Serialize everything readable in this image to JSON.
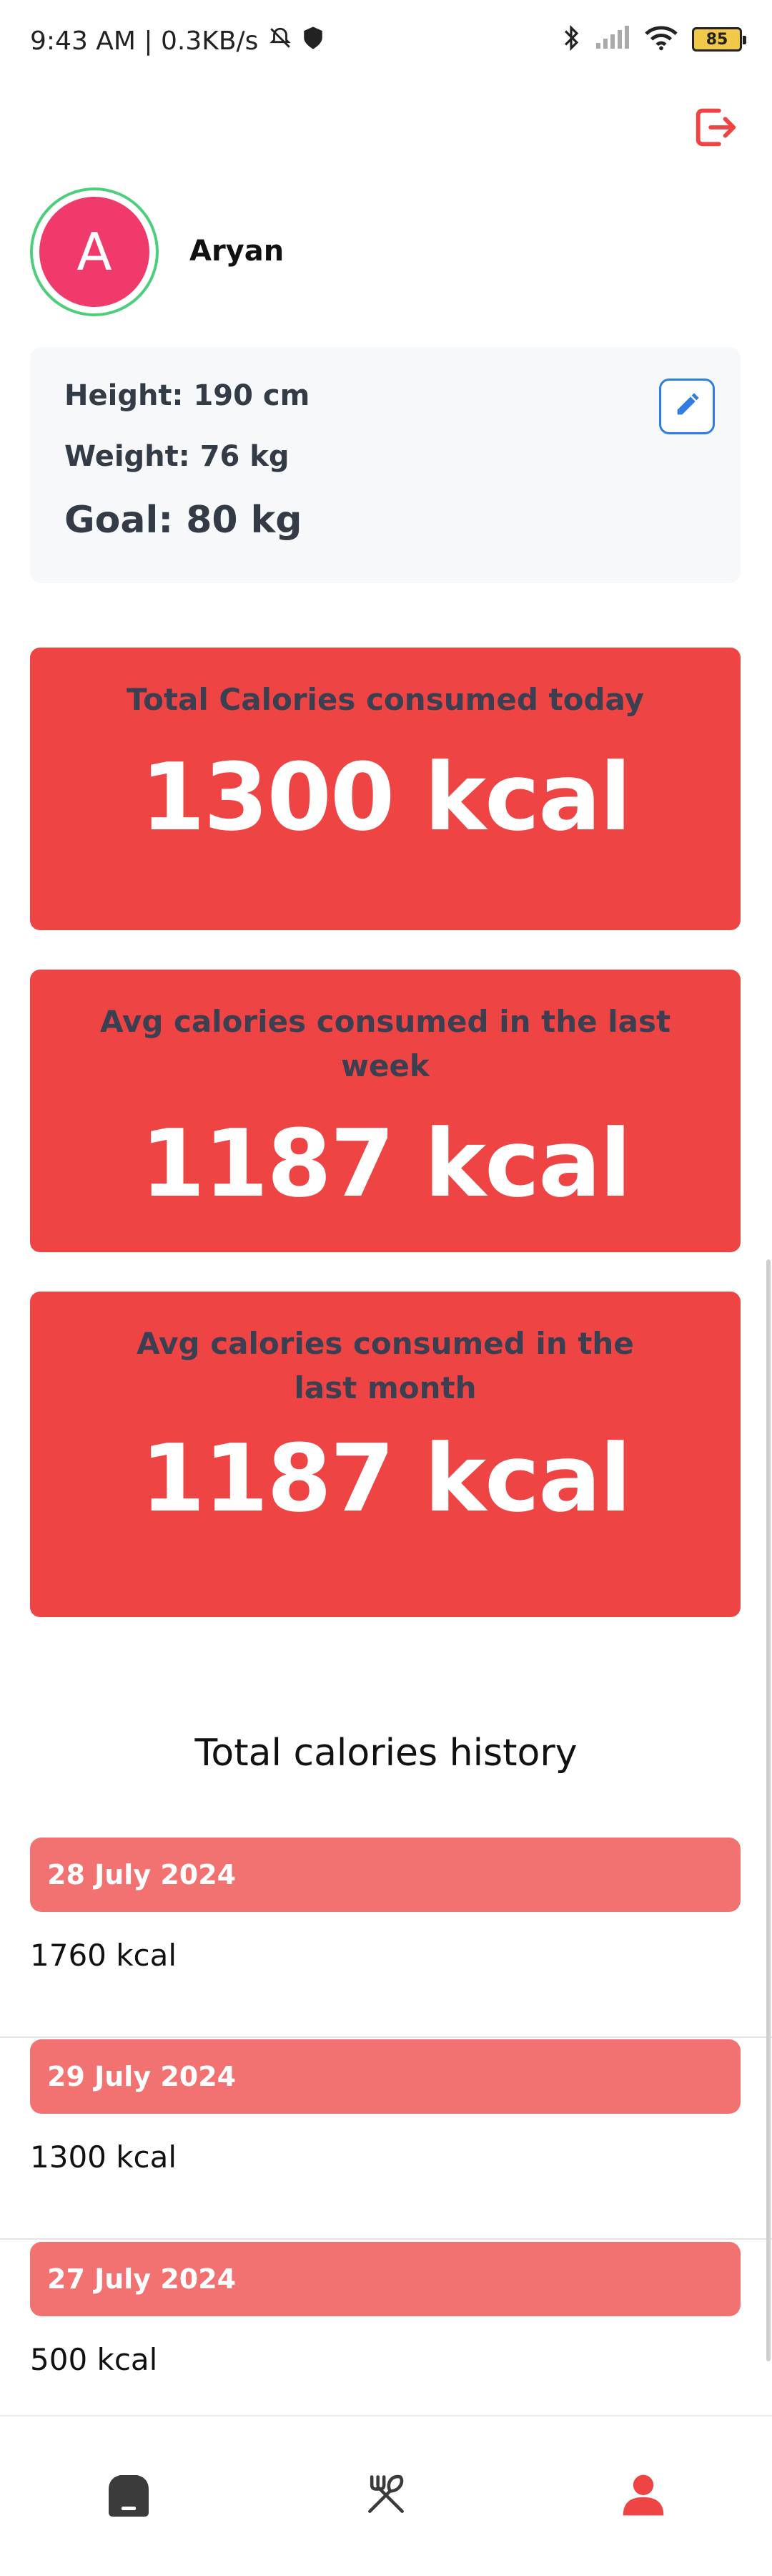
{
  "status_bar": {
    "time_net": "9:43 AM | 0.3KB/s",
    "battery": "85"
  },
  "profile": {
    "avatar_letter": "A",
    "name": "Aryan",
    "height": "Height: 190 cm",
    "weight": "Weight: 76 kg",
    "goal": "Goal: 80 kg"
  },
  "cards": [
    {
      "label": "Total Calories consumed today",
      "value": "1300 kcal"
    },
    {
      "label": "Avg calories consumed in the last week",
      "value": "1187 kcal"
    },
    {
      "label": "Avg calories consumed in the last month",
      "value": "1187 kcal"
    }
  ],
  "history": {
    "title": "Total calories history",
    "items": [
      {
        "date": "28 July 2024",
        "kcal": "1760 kcal"
      },
      {
        "date": "29 July 2024",
        "kcal": "1300 kcal"
      },
      {
        "date": "27 July 2024",
        "kcal": "500 kcal"
      }
    ]
  },
  "nav": {
    "items": [
      "home-icon",
      "utensils-icon",
      "profile-icon"
    ],
    "active": "profile-icon",
    "active_color": "#ef4444",
    "inactive_color": "#3b3b3b"
  },
  "colors": {
    "card": "#ef4444",
    "history_header": "#f27171",
    "avatar": "#ef3a6b",
    "avatar_ring": "#4ccf7a",
    "edit": "#2f7de0",
    "logout": "#ef4444"
  }
}
